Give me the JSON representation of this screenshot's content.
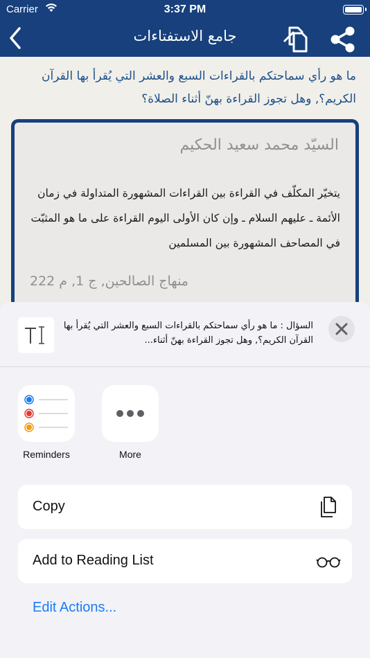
{
  "status_bar": {
    "carrier": "Carrier",
    "time": "3:37 PM"
  },
  "nav": {
    "title": "جامع الاستفتاءات"
  },
  "question": {
    "text": "ما هو رأي سماحتكم بالقراءات السبع والعشر التي يُقرأ بها القرآن الكريم؟, وهل تجوز القراءة بهنّ أثناء الصلاة؟"
  },
  "answer": {
    "scholar": "السيّد محمد سعيد الحكيم",
    "text": "يتخيّر المكلّف في القراءة بين القراءات المشهورة المتداولة في زمان الأئمة ـ عليهم السلام ـ وإن كان الأولى اليوم القراءة على ما هو المثبّت في المصاحف المشهورة بين المسلمين",
    "source": "منهاج الصالحين, ج 1, م 222"
  },
  "share_sheet": {
    "preview_text": "السؤال : ما هو رأي سماحتكم بالقراءات السبع والعشر التي يُقرأ بها القرآن الكريم؟, وهل تجوز القراءة بهنّ أثناء...",
    "apps": [
      {
        "label": "Reminders",
        "icon": "reminders-icon"
      },
      {
        "label": "More",
        "icon": "more-icon"
      }
    ],
    "actions": [
      {
        "label": "Copy",
        "icon": "copy-icon"
      },
      {
        "label": "Add to Reading List",
        "icon": "glasses-icon"
      }
    ],
    "edit_actions": "Edit Actions..."
  },
  "colors": {
    "brand": "#17407c",
    "question_text": "#1c4f8a",
    "link": "#1a7cf5",
    "reminder_blue": "#1a7cf5",
    "reminder_red": "#e53b30",
    "reminder_orange": "#f39c12"
  }
}
